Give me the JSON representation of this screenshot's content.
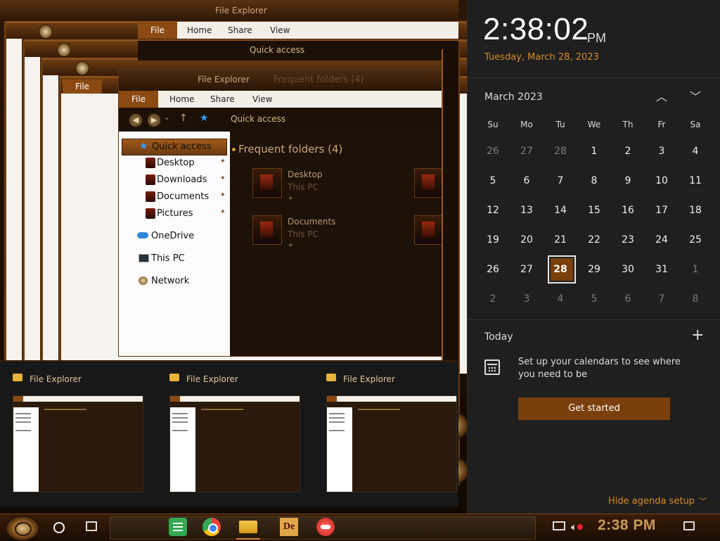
{
  "background": {
    "ghost_title": "File Explorer",
    "ghost_ribbon": [
      "File",
      "Home",
      "Share",
      "View"
    ],
    "ghost_quick_access": "Quick access",
    "cascade_file_label": "File"
  },
  "explorer": {
    "title": "File Explorer",
    "dim_header": "Frequent folders (4)",
    "ribbon": {
      "file": "File",
      "home": "Home",
      "share": "Share",
      "view": "View"
    },
    "address": "Quick access",
    "nav": {
      "quick_access": "Quick access",
      "desktop": "Desktop",
      "downloads": "Downloads",
      "documents": "Documents",
      "pictures": "Pictures",
      "onedrive": "OneDrive",
      "this_pc": "This PC",
      "network": "Network"
    },
    "section": "Frequent folders (4)",
    "tiles": [
      {
        "name": "Desktop",
        "sub": "This PC"
      },
      {
        "name": "Documents",
        "sub": "This PC"
      }
    ]
  },
  "task_view": [
    {
      "title": "File Explorer"
    },
    {
      "title": "File Explorer"
    },
    {
      "title": "File Explorer"
    }
  ],
  "flyout": {
    "time": "2:38:02",
    "ampm": "PM",
    "date": "Tuesday, March 28, 2023",
    "month": "March 2023",
    "weekdays": [
      "Su",
      "Mo",
      "Tu",
      "We",
      "Th",
      "Fr",
      "Sa"
    ],
    "weeks": [
      [
        "26",
        "27",
        "28",
        "1",
        "2",
        "3",
        "4"
      ],
      [
        "5",
        "6",
        "7",
        "8",
        "9",
        "10",
        "11"
      ],
      [
        "12",
        "13",
        "14",
        "15",
        "16",
        "17",
        "18"
      ],
      [
        "19",
        "20",
        "21",
        "22",
        "23",
        "24",
        "25"
      ],
      [
        "26",
        "27",
        "28",
        "29",
        "30",
        "31",
        "1"
      ],
      [
        "2",
        "3",
        "4",
        "5",
        "6",
        "7",
        "8"
      ]
    ],
    "today_label": "Today",
    "agenda_message": "Set up your calendars to see where you need to be",
    "get_started": "Get started",
    "hide_agenda": "Hide agenda setup"
  },
  "taskbar": {
    "clock": "2:38 PM",
    "apps": [
      "google-keep-icon",
      "chrome-icon",
      "file-explorer-icon",
      "de-icon",
      "red-app-icon"
    ]
  },
  "colors": {
    "accent": "#d68a2a",
    "today_fill": "#7a3f0c",
    "button_fill": "#7a3f0c"
  }
}
